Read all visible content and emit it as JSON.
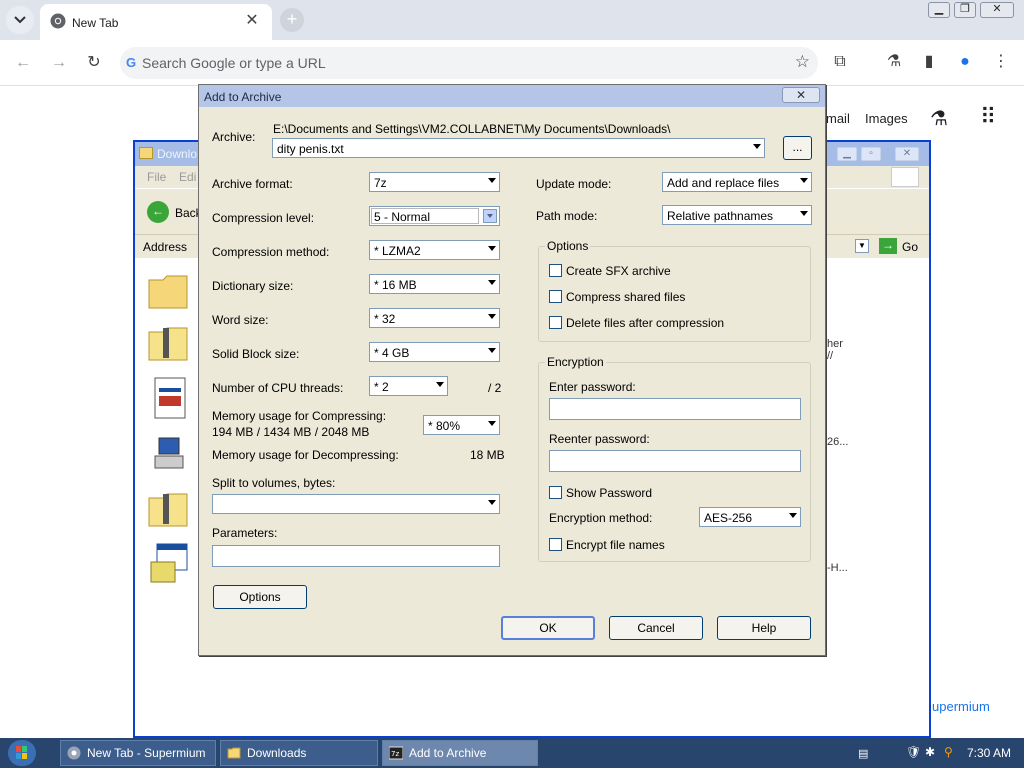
{
  "browser": {
    "tab_title": "New Tab",
    "omnibox_placeholder": "Search Google or type a URL",
    "ntp_links": {
      "gmail": "mail",
      "images": "Images"
    },
    "supermium_chip": "upermium"
  },
  "explorer": {
    "title": "Downlo",
    "menu": {
      "file": "File",
      "edit": "Edi"
    },
    "back_label": "Back",
    "address_label": "Address",
    "go_label": "Go",
    "side_texts": {
      "t1": "her",
      "t2": "//",
      "t3": "26...",
      "t4": "-H..."
    }
  },
  "dialog": {
    "title": "Add to Archive",
    "archive_label": "Archive:",
    "archive_path": "E:\\Documents and Settings\\VM2.COLLABNET\\My Documents\\Downloads\\",
    "archive_name": "dity penis.txt",
    "browse_label": "...",
    "left": {
      "archive_format": {
        "label": "Archive format:",
        "value": "7z"
      },
      "compression_level": {
        "label": "Compression level:",
        "value": "5 - Normal"
      },
      "compression_method": {
        "label": "Compression method:",
        "value": "* LZMA2"
      },
      "dictionary_size": {
        "label": "Dictionary size:",
        "value": "* 16 MB"
      },
      "word_size": {
        "label": "Word size:",
        "value": "* 32"
      },
      "solid_block_size": {
        "label": "Solid Block size:",
        "value": "* 4 GB"
      },
      "cpu_threads": {
        "label": "Number of CPU threads:",
        "value": "* 2",
        "max": "/ 2"
      },
      "mem_compress": {
        "label": "Memory usage for Compressing:",
        "detail": "194 MB / 1434 MB / 2048 MB",
        "value": "* 80%"
      },
      "mem_decompress": {
        "label": "Memory usage for Decompressing:",
        "value": "18 MB"
      },
      "split": {
        "label": "Split to volumes, bytes:",
        "value": ""
      },
      "parameters": {
        "label": "Parameters:",
        "value": ""
      },
      "options_button": "Options"
    },
    "right": {
      "update_mode": {
        "label": "Update mode:",
        "value": "Add and replace files"
      },
      "path_mode": {
        "label": "Path mode:",
        "value": "Relative pathnames"
      },
      "options_group": {
        "title": "Options",
        "create_sfx": "Create SFX archive",
        "compress_shared": "Compress shared files",
        "delete_after": "Delete files after compression"
      },
      "encryption_group": {
        "title": "Encryption",
        "enter_password": "Enter password:",
        "reenter_password": "Reenter password:",
        "show_password": "Show Password",
        "method_label": "Encryption method:",
        "method_value": "AES-256",
        "encrypt_names": "Encrypt file names"
      }
    },
    "buttons": {
      "ok": "OK",
      "cancel": "Cancel",
      "help": "Help"
    }
  },
  "taskbar": {
    "items": [
      "New Tab - Supermium",
      "Downloads",
      "Add to Archive"
    ],
    "clock": "7:30 AM"
  },
  "colors": {
    "dialog_bg": "#ece9d8",
    "taskbar": "#27456d",
    "xp_border": "#0a3fd6"
  }
}
